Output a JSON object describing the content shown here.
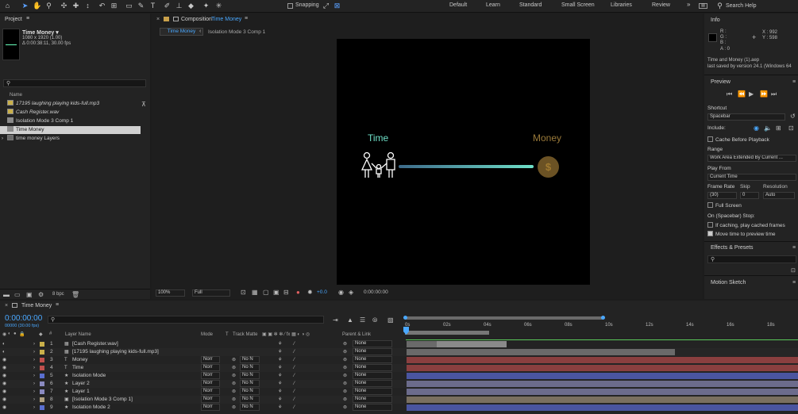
{
  "toolbar": {
    "snapping_label": "Snapping",
    "workspaces": [
      "Default",
      "Learn",
      "Standard",
      "Small Screen",
      "Libraries",
      "Review"
    ],
    "search_placeholder": "Search Help"
  },
  "project": {
    "panel_title": "Project",
    "comp_name": "Time Money ▾",
    "comp_size": "1080 x 1920 (1.00)",
    "comp_duration": "Δ 0:00:38:11, 30.00 fps",
    "column_name": "Name",
    "items": [
      {
        "name": "17195 laughing playing kids-full.mp3",
        "type": "audio"
      },
      {
        "name": "Cash Register.wav",
        "type": "audio"
      },
      {
        "name": "Isolation Mode 3 Comp 1",
        "type": "comp"
      },
      {
        "name": "Time Money",
        "type": "comp",
        "selected": true
      },
      {
        "name": "time money Layers",
        "type": "folder"
      }
    ],
    "bpc": "8 bpc"
  },
  "viewer": {
    "comp_tab_prefix": "Composition",
    "comp_tab_name": "Time Money",
    "breadcrumbs": [
      "Time Money",
      "Isolation Mode 3 Comp 1"
    ],
    "canvas": {
      "left_text": "Time",
      "right_text": "Money",
      "coin_symbol": "$",
      "left_color": "#6fe0c8",
      "right_color": "#9a7a3a"
    },
    "zoom": "100%",
    "resolution": "Full",
    "exposure": "+0.0",
    "timecode": "0:00:00:00"
  },
  "info": {
    "title": "Info",
    "r": "R :",
    "g": "G :",
    "b": "B :",
    "a": "A : 0",
    "x": "X : 992",
    "y": "Y : 598",
    "file": "Time and Money (1).aep",
    "saved": "last saved by version 24.1 (Windows 64"
  },
  "preview": {
    "title": "Preview",
    "shortcut_label": "Shortcut",
    "shortcut_value": "Spacebar",
    "include_label": "Include:",
    "cache_label": "Cache Before Playback",
    "range_label": "Range",
    "range_value": "Work Area Extended By Current ...",
    "play_from_label": "Play From",
    "play_from_value": "Current Time",
    "frame_rate_label": "Frame Rate",
    "skip_label": "Skip",
    "resolution_label": "Resolution",
    "frame_rate_value": "(30)",
    "skip_value": "0",
    "resolution_value": "Auto",
    "full_screen_label": "Full Screen",
    "on_stop_label": "On (Spacebar) Stop:",
    "if_caching_label": "If caching, play cached frames",
    "move_time_label": "Move time to preview time"
  },
  "effects": {
    "title": "Effects & Presets"
  },
  "motion_sketch": {
    "title": "Motion Sketch"
  },
  "timeline": {
    "tab": "Time Money",
    "timecode": "0:00:00:00",
    "timecode_sub": "00000 (30.00 fps)",
    "col_layer_name": "Layer Name",
    "col_mode": "Mode",
    "col_t": "T",
    "col_track_matte": "Track Matte",
    "col_parent": "Parent & Link",
    "ruler": [
      "0s",
      "02s",
      "04s",
      "06s",
      "08s",
      "10s",
      "12s",
      "14s",
      "16s",
      "18s"
    ],
    "layers": [
      {
        "num": "1",
        "name": "[Cash Register.wav]",
        "kind": "audio",
        "label": "#c9b04a",
        "mode": "",
        "matte": "",
        "parent": "None",
        "bar": "#6a6a6a"
      },
      {
        "num": "2",
        "name": "[17195 laughing playing kids-full.mp3]",
        "kind": "audio",
        "label": "#c9b04a",
        "mode": "",
        "matte": "",
        "parent": "None",
        "bar": "#6a6a6a"
      },
      {
        "num": "3",
        "name": "Money",
        "kind": "text",
        "label": "#c0504d",
        "mode": "Norr",
        "matte": "No N",
        "parent": "None",
        "bar": "#8a3f3f"
      },
      {
        "num": "4",
        "name": "Time",
        "kind": "text",
        "label": "#c0504d",
        "mode": "Norr",
        "matte": "No N",
        "parent": "None",
        "bar": "#8a3f3f"
      },
      {
        "num": "5",
        "name": "Isolation Mode",
        "kind": "shape",
        "label": "#5a6fd0",
        "mode": "Norr",
        "matte": "No N",
        "parent": "None",
        "bar": "#4a55a0"
      },
      {
        "num": "6",
        "name": "Layer 2",
        "kind": "shape",
        "label": "#8a8ac0",
        "mode": "Norr",
        "matte": "No N",
        "parent": "None",
        "bar": "#6c6c8c"
      },
      {
        "num": "7",
        "name": "Layer 1",
        "kind": "shape",
        "label": "#8a8ac0",
        "mode": "Norr",
        "matte": "No N",
        "parent": "None",
        "bar": "#6c6c8c"
      },
      {
        "num": "8",
        "name": "[Isolation Mode 3 Comp 1]",
        "kind": "comp",
        "label": "#b0a080",
        "mode": "Norr",
        "matte": "No N",
        "parent": "None",
        "bar": "#7a7060"
      },
      {
        "num": "9",
        "name": "Isolation Mode 2",
        "kind": "shape",
        "label": "#5a6fd0",
        "mode": "Norr",
        "matte": "No N",
        "parent": "None",
        "bar": "#4a55a0"
      }
    ]
  }
}
